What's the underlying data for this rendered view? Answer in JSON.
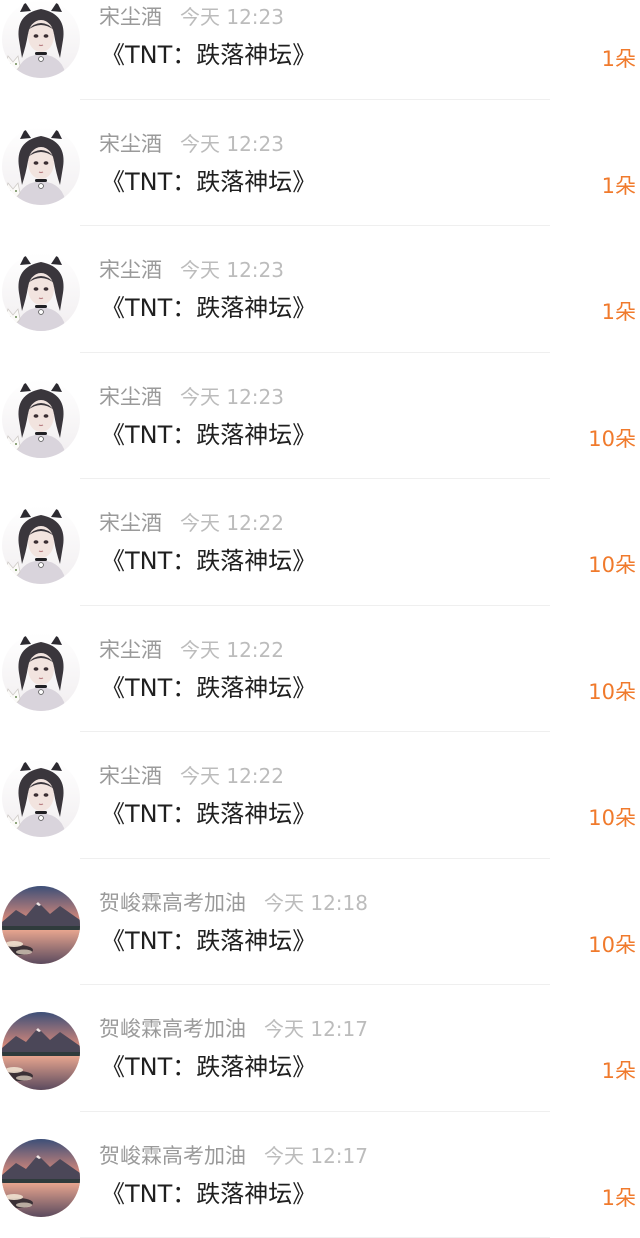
{
  "colors": {
    "name": "#9a9a9a",
    "time": "#bcbcbc",
    "gift": "#1f1f1f",
    "quantity": "#f07a2c",
    "divider": "#efefef"
  },
  "records": [
    {
      "avatar": "anime-girl-avatar",
      "name": "宋尘酒",
      "time": "今天 12:23",
      "gift": "《TNT：跌落神坛》",
      "quantity": "1朵"
    },
    {
      "avatar": "anime-girl-avatar",
      "name": "宋尘酒",
      "time": "今天 12:23",
      "gift": "《TNT：跌落神坛》",
      "quantity": "1朵"
    },
    {
      "avatar": "anime-girl-avatar",
      "name": "宋尘酒",
      "time": "今天 12:23",
      "gift": "《TNT：跌落神坛》",
      "quantity": "1朵"
    },
    {
      "avatar": "anime-girl-avatar",
      "name": "宋尘酒",
      "time": "今天 12:23",
      "gift": "《TNT：跌落神坛》",
      "quantity": "10朵"
    },
    {
      "avatar": "anime-girl-avatar",
      "name": "宋尘酒",
      "time": "今天 12:22",
      "gift": "《TNT：跌落神坛》",
      "quantity": "10朵"
    },
    {
      "avatar": "anime-girl-avatar",
      "name": "宋尘酒",
      "time": "今天 12:22",
      "gift": "《TNT：跌落神坛》",
      "quantity": "10朵"
    },
    {
      "avatar": "anime-girl-avatar",
      "name": "宋尘酒",
      "time": "今天 12:22",
      "gift": "《TNT：跌落神坛》",
      "quantity": "10朵"
    },
    {
      "avatar": "mountain-lake-avatar",
      "name": "贺峻霖高考加油",
      "time": "今天 12:18",
      "gift": "《TNT：跌落神坛》",
      "quantity": "10朵"
    },
    {
      "avatar": "mountain-lake-avatar",
      "name": "贺峻霖高考加油",
      "time": "今天 12:17",
      "gift": "《TNT：跌落神坛》",
      "quantity": "1朵"
    },
    {
      "avatar": "mountain-lake-avatar",
      "name": "贺峻霖高考加油",
      "time": "今天 12:17",
      "gift": "《TNT：跌落神坛》",
      "quantity": "1朵"
    }
  ]
}
